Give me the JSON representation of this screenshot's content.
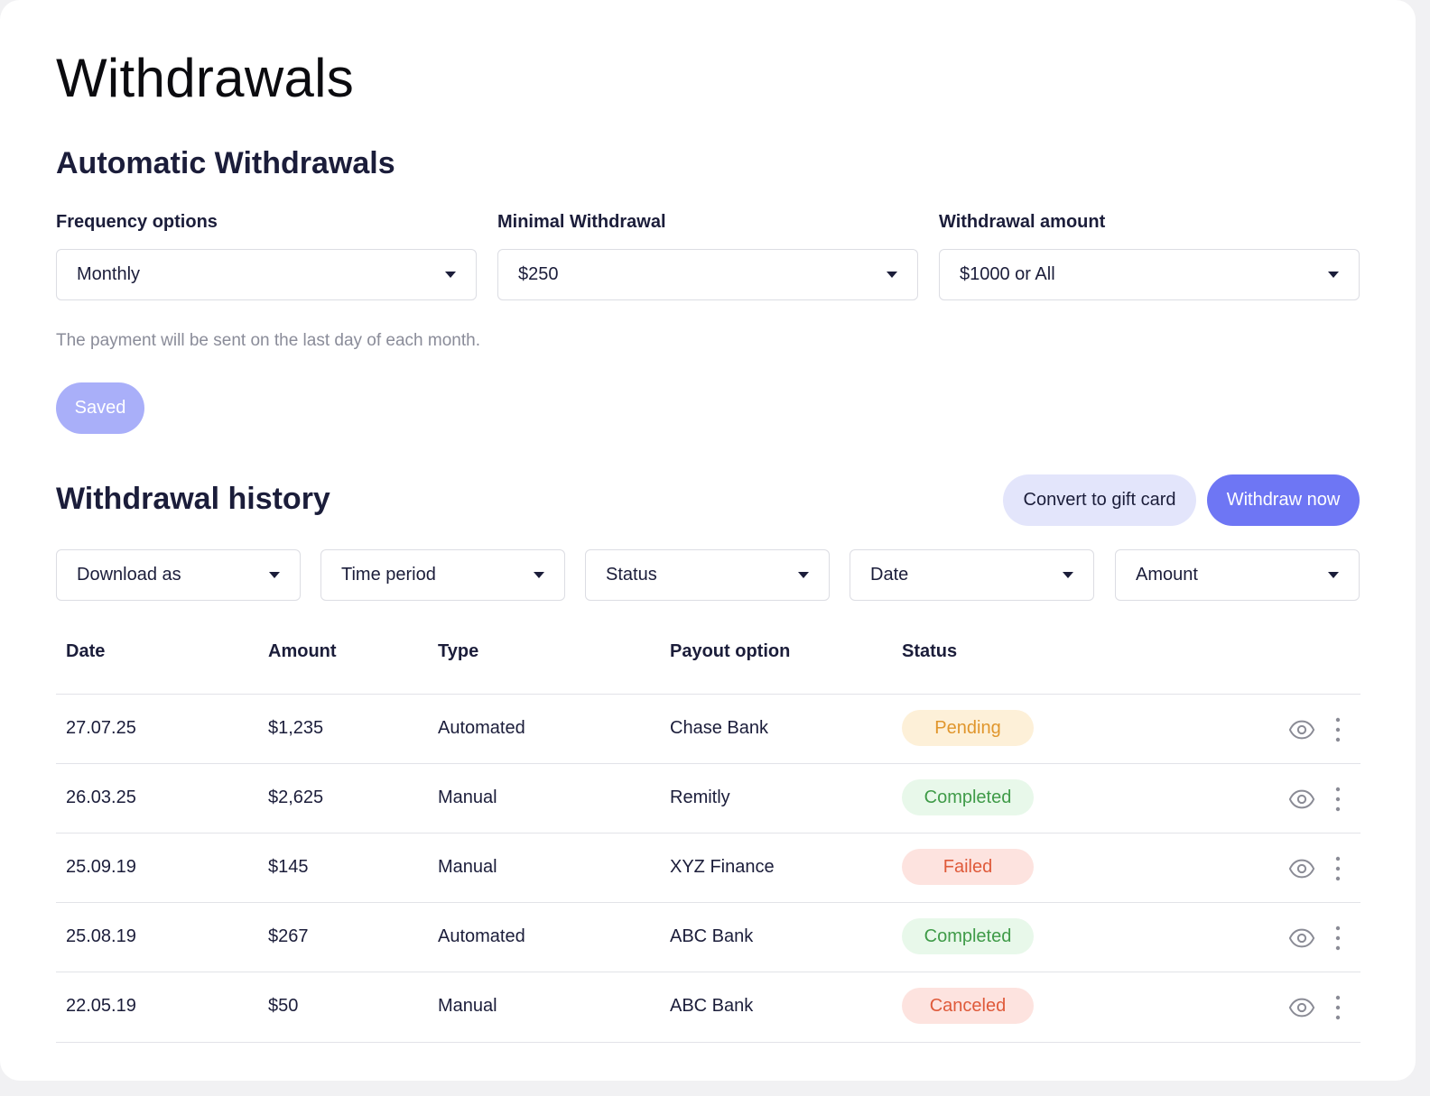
{
  "page": {
    "title": "Withdrawals"
  },
  "automatic": {
    "heading": "Automatic Withdrawals",
    "fields": [
      {
        "label": "Frequency options",
        "value": "Monthly"
      },
      {
        "label": "Minimal Withdrawal",
        "value": "$250"
      },
      {
        "label": "Withdrawal amount",
        "value": "$1000 or All"
      }
    ],
    "helper": "The payment will be sent on the last day of each month.",
    "saved_label": "Saved"
  },
  "history": {
    "heading": "Withdrawal history",
    "gift_label": "Convert to gift card",
    "withdraw_label": "Withdraw now",
    "filters": [
      "Download as",
      "Time period",
      "Status",
      "Date",
      "Amount"
    ],
    "columns": [
      "Date",
      "Amount",
      "Type",
      "Payout option",
      "Status"
    ],
    "rows": [
      {
        "date": "27.07.25",
        "amount": "$1,235",
        "type": "Automated",
        "payout": "Chase Bank",
        "status": "Pending"
      },
      {
        "date": "26.03.25",
        "amount": "$2,625",
        "type": "Manual",
        "payout": "Remitly",
        "status": "Completed"
      },
      {
        "date": "25.09.19",
        "amount": "$145",
        "type": "Manual",
        "payout": "XYZ Finance",
        "status": "Failed"
      },
      {
        "date": "25.08.19",
        "amount": "$267",
        "type": "Automated",
        "payout": "ABC Bank",
        "status": "Completed"
      },
      {
        "date": "22.05.19",
        "amount": "$50",
        "type": "Manual",
        "payout": "ABC Bank",
        "status": "Canceled"
      }
    ]
  },
  "colors": {
    "accent": "#6e76f4",
    "accent_soft": "#a9aff9",
    "pending_bg": "#fdf0d8",
    "pending_fg": "#e0962c",
    "completed_bg": "#e8f8ea",
    "completed_fg": "#3f9b48",
    "failed_bg": "#fde3df",
    "failed_fg": "#df5a3a",
    "canceled_bg": "#fde3df",
    "canceled_fg": "#df5a3a"
  },
  "icons": {
    "row_view": "eye-icon",
    "row_menu": "more-vertical-icon",
    "dropdown": "caret-down-icon"
  }
}
